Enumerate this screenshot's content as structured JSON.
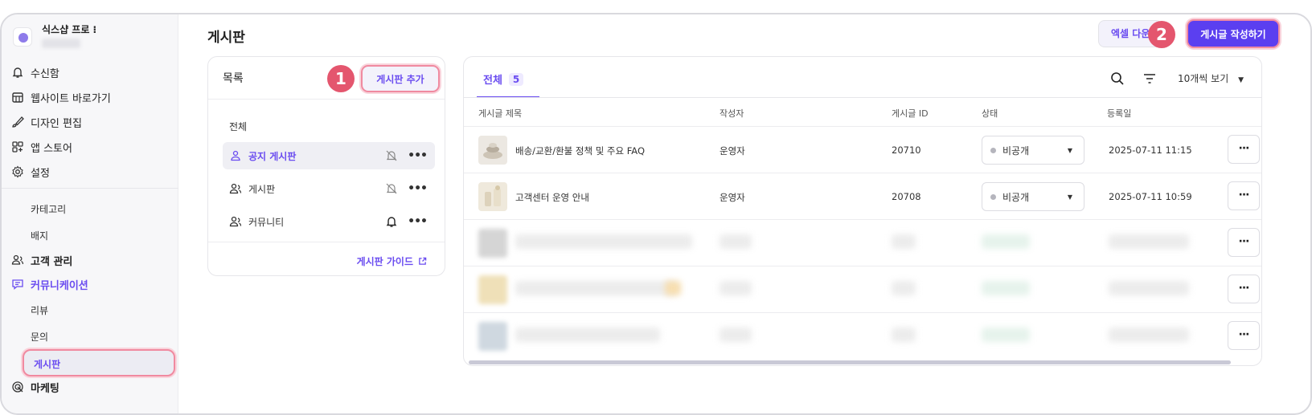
{
  "app": {
    "brand_name": "식스샵 프로 ⁝"
  },
  "sidebar": {
    "items": [
      {
        "label": "수신함",
        "icon": "bell-icon"
      },
      {
        "label": "웹사이트 바로가기",
        "icon": "store-icon"
      },
      {
        "label": "디자인 편집",
        "icon": "brush-icon"
      },
      {
        "label": "앱 스토어",
        "icon": "apps-icon"
      },
      {
        "label": "설정",
        "icon": "gear-icon"
      }
    ],
    "sub_items": [
      "카테고리",
      "배지"
    ],
    "customer": "고객 관리",
    "communication": "커뮤니케이션",
    "comm_sub": [
      "리뷰",
      "문의",
      "게시판"
    ],
    "marketing": "마케팅"
  },
  "header": {
    "title": "게시판",
    "excel_label": "엑셀 다운",
    "write_label": "게시글 작성하기"
  },
  "callouts": [
    "1",
    "2"
  ],
  "list_panel": {
    "title": "목록",
    "add_label": "게시판 추가",
    "all_label": "전체",
    "boards": [
      {
        "name": "공지 게시판",
        "notify": "off"
      },
      {
        "name": "게시판",
        "notify": "off"
      },
      {
        "name": "커뮤니티",
        "notify": "on"
      }
    ],
    "guide_label": "게시판 가이드"
  },
  "table": {
    "tab_label": "전체",
    "tab_count": "5",
    "per_page": "10개씩 보기",
    "columns": [
      "게시글 제목",
      "작성자",
      "게시글 ID",
      "상태",
      "등록일"
    ],
    "rows": [
      {
        "title": "배송/교환/환불 정책 및 주요 FAQ",
        "author": "운영자",
        "id": "20710",
        "status": "비공개",
        "date": "2025-07-11 11:15"
      },
      {
        "title": "고객센터 운영 안내",
        "author": "운영자",
        "id": "20708",
        "status": "비공개",
        "date": "2025-07-11 10:59"
      }
    ],
    "more_label": "···"
  },
  "colors": {
    "accent": "#6a4cf0",
    "callout": "#e4566e",
    "highlight": "#f08aa0"
  }
}
